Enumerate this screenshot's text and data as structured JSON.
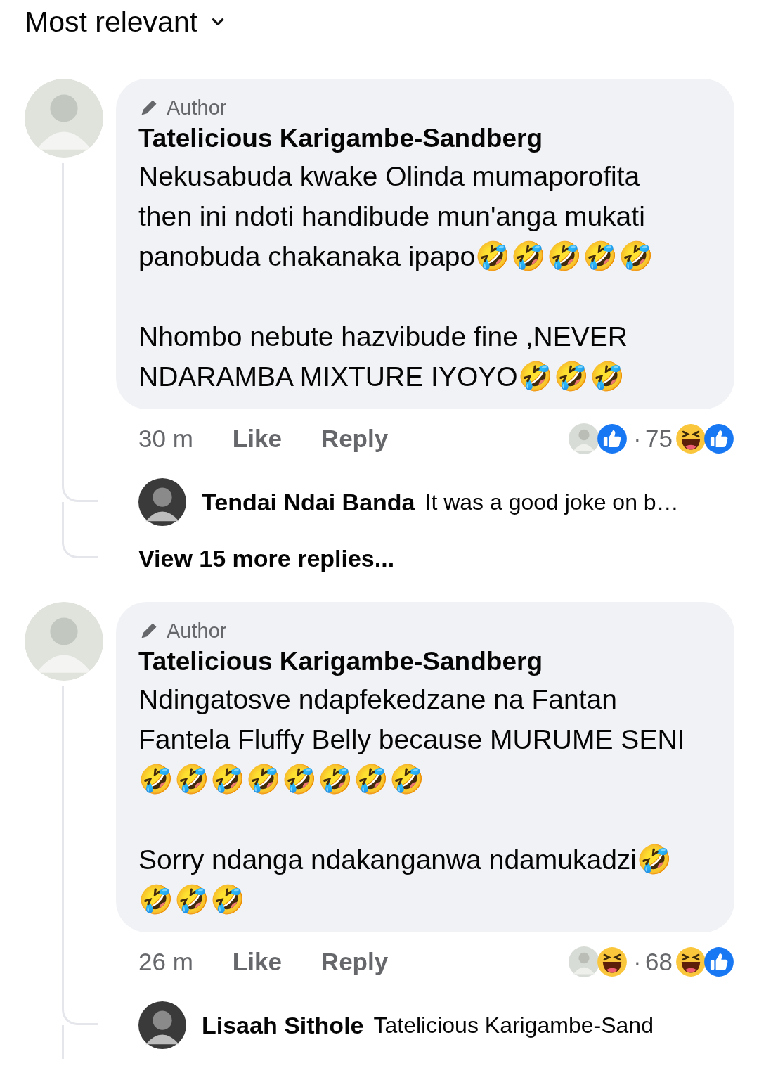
{
  "sort": {
    "label": "Most relevant"
  },
  "comments": [
    {
      "badge": "Author",
      "name": "Tatelicious Karigambe-Sandberg",
      "paragraphs": [
        {
          "text": "Nekusabuda kwake Olinda mumaporofita then ini ndoti handibude mun'anga mukati panobuda chakanaka ipapo",
          "emoji": "🤣🤣🤣🤣🤣"
        },
        {
          "text": "Nhombo nebute hazvibude fine ,NEVER NDARAMBA MIXTURE IYOYO",
          "emoji": "🤣🤣🤣"
        }
      ],
      "time": "30 m",
      "like": "Like",
      "reply": "Reply",
      "reactions_left": [
        {
          "kind": "avatar"
        },
        {
          "kind": "like"
        }
      ],
      "dot": "·",
      "count": "75",
      "reactions_right": [
        {
          "kind": "haha"
        },
        {
          "kind": "like"
        }
      ],
      "replies": [
        {
          "name": "Tendai Ndai Banda",
          "text": "It was a good joke on b…"
        }
      ],
      "more": "View 15 more replies..."
    },
    {
      "badge": "Author",
      "name": "Tatelicious Karigambe-Sandberg",
      "paragraphs": [
        {
          "text": "Ndingatosve ndapfekedzane na Fantan Fantela Fluffy Belly because MURUME SENI",
          "emoji": "🤣🤣🤣🤣🤣🤣🤣🤣"
        },
        {
          "text": "Sorry ndanga ndakanganwa ndamukadzi",
          "emoji": "🤣🤣🤣🤣"
        }
      ],
      "time": "26 m",
      "like": "Like",
      "reply": "Reply",
      "reactions_left": [
        {
          "kind": "avatar"
        },
        {
          "kind": "haha"
        }
      ],
      "dot": "·",
      "count": "68",
      "reactions_right": [
        {
          "kind": "haha"
        },
        {
          "kind": "like"
        }
      ],
      "replies": [
        {
          "name": "Lisaah Sithole",
          "text": "Tatelicious Karigambe-Sand"
        }
      ]
    }
  ]
}
